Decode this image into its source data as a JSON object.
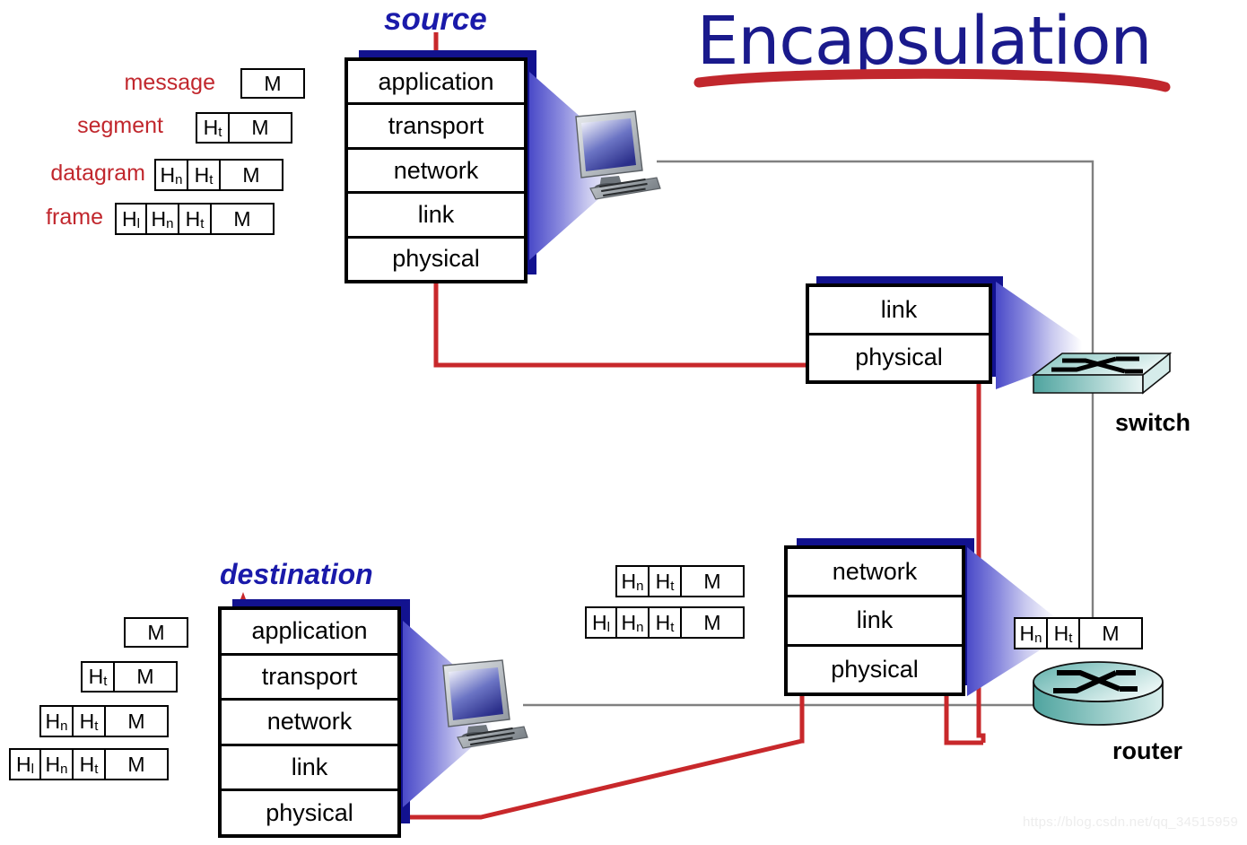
{
  "title": {
    "text": "Encapsulation",
    "color": "#1a1a8c",
    "underline_color": "#c1272d"
  },
  "captions": {
    "source": "source",
    "destination": "destination"
  },
  "pdu_labels": {
    "message": "message",
    "segment": "segment",
    "datagram": "datagram",
    "frame": "frame",
    "color": "#c1272d"
  },
  "headers": {
    "transport": "Ht",
    "network": "Hn",
    "link": "Hl",
    "payload": "M"
  },
  "source_pdus": [
    {
      "label": "message",
      "cells": [
        "M"
      ]
    },
    {
      "label": "segment",
      "cells": [
        "Ht",
        "M"
      ]
    },
    {
      "label": "datagram",
      "cells": [
        "Hn",
        "Ht",
        "M"
      ]
    },
    {
      "label": "frame",
      "cells": [
        "Hl",
        "Hn",
        "Ht",
        "M"
      ]
    }
  ],
  "destination_pdus": [
    {
      "cells": [
        "M"
      ]
    },
    {
      "cells": [
        "Ht",
        "M"
      ]
    },
    {
      "cells": [
        "Hn",
        "Ht",
        "M"
      ]
    },
    {
      "cells": [
        "Hl",
        "Hn",
        "Ht",
        "M"
      ]
    }
  ],
  "router_pdus": [
    {
      "cells": [
        "Hn",
        "Ht",
        "M"
      ]
    },
    {
      "cells": [
        "Hl",
        "Hn",
        "Ht",
        "M"
      ]
    }
  ],
  "router_right_pdu": {
    "cells": [
      "Hn",
      "Ht",
      "M"
    ]
  },
  "stacks": {
    "source": {
      "name": "source",
      "layers": [
        "application",
        "transport",
        "network",
        "link",
        "physical"
      ]
    },
    "destination": {
      "name": "destination",
      "layers": [
        "application",
        "transport",
        "network",
        "link",
        "physical"
      ]
    },
    "switch": {
      "name": "switch",
      "layers": [
        "link",
        "physical"
      ]
    },
    "router": {
      "name": "router",
      "layers": [
        "network",
        "link",
        "physical"
      ]
    }
  },
  "devices": {
    "switch_label": "switch",
    "router_label": "router"
  },
  "colors": {
    "stack_blue": "#12128f",
    "caption_blue": "#1a1aaa",
    "path_red": "#c8282b",
    "label_red": "#c1272d",
    "wire_gray": "#808080",
    "device_teal_dark": "#3f9a96",
    "device_teal_light": "#e7f4f3"
  },
  "watermark": "https://blog.csdn.net/qq_34515959"
}
